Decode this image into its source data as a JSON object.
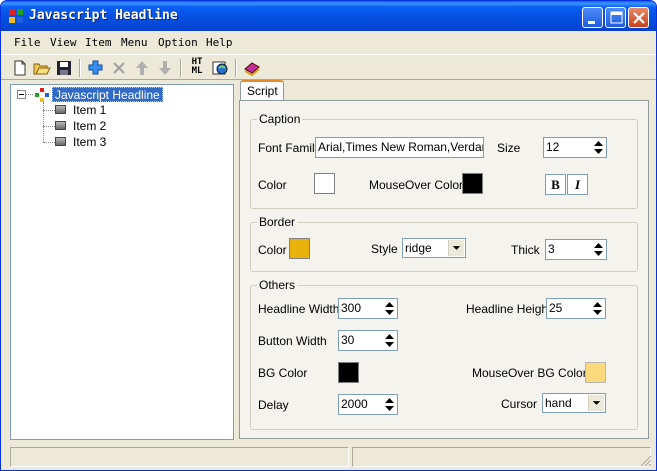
{
  "window": {
    "title": "Javascript Headline"
  },
  "menu": [
    "File",
    "View",
    "Item",
    "Menu",
    "Option",
    "Help"
  ],
  "toolbar": {
    "icons": [
      "new-icon",
      "open-icon",
      "save-icon",
      "add-icon",
      "delete-icon",
      "move-up-icon",
      "move-down-icon",
      "html-icon",
      "preview-icon",
      "help-icon"
    ],
    "html_label_top": "HT",
    "html_label_bottom": "ML"
  },
  "tree": {
    "root": "Javascript Headline",
    "items": [
      "Item 1",
      "Item 2",
      "Item 3"
    ]
  },
  "tabs": [
    "Script"
  ],
  "caption": {
    "title": "Caption",
    "font_family_label": "Font Family",
    "font_family_value": "Arial,Times New Roman,Verdana",
    "size_label": "Size",
    "size_value": "12",
    "color_label": "Color",
    "color_value": "#ffffff",
    "mouseover_label": "MouseOver Color",
    "mouseover_value": "#000000",
    "bold": "B",
    "italic": "I"
  },
  "border": {
    "title": "Border",
    "color_label": "Color",
    "color_value": "#e8b40c",
    "style_label": "Style",
    "style_value": "ridge",
    "thick_label": "Thick",
    "thick_value": "3"
  },
  "others": {
    "title": "Others",
    "headline_width_label": "Headline Width",
    "headline_width_value": "300",
    "headline_height_label": "Headline Height",
    "headline_height_value": "25",
    "button_width_label": "Button Width",
    "button_width_value": "30",
    "bg_color_label": "BG Color",
    "bg_color_value": "#000000",
    "mouseover_bg_label": "MouseOver BG Color",
    "mouseover_bg_value": "#fcd97a",
    "delay_label": "Delay",
    "delay_value": "2000",
    "cursor_label": "Cursor",
    "cursor_value": "hand"
  }
}
